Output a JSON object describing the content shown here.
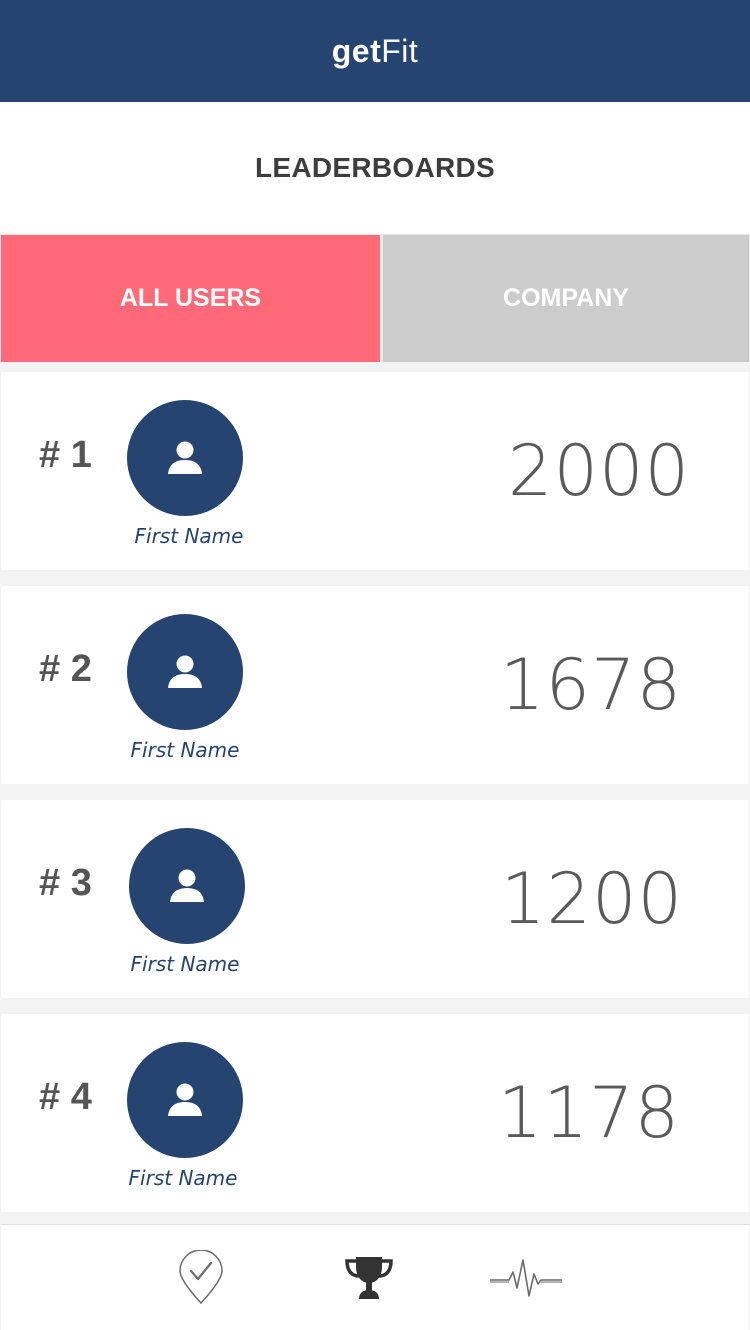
{
  "app": {
    "brand_bold": "get",
    "brand_light": "Fit"
  },
  "header": {
    "title": "LEADERBOARDS"
  },
  "tabs": [
    {
      "label": "ALL USERS",
      "active": true
    },
    {
      "label": "COMPANY",
      "active": false
    }
  ],
  "leaderboard": [
    {
      "rank": "# 1",
      "name": "First Name",
      "score": "2000"
    },
    {
      "rank": "# 2",
      "name": "First Name",
      "score": "1678"
    },
    {
      "rank": "# 3",
      "name": "First Name",
      "score": "1200"
    },
    {
      "rank": "# 4",
      "name": "First Name",
      "score": "1178"
    }
  ],
  "bottom_nav": [
    {
      "icon": "check-pin-icon",
      "active": false
    },
    {
      "icon": "trophy-icon",
      "active": true
    },
    {
      "icon": "heartbeat-icon",
      "active": false
    }
  ],
  "colors": {
    "navy": "#254470",
    "tab_active": "#ff6978",
    "tab_inactive": "#cccccc",
    "text_dark": "#3d3d3d",
    "score_text": "#5a5a5a"
  }
}
